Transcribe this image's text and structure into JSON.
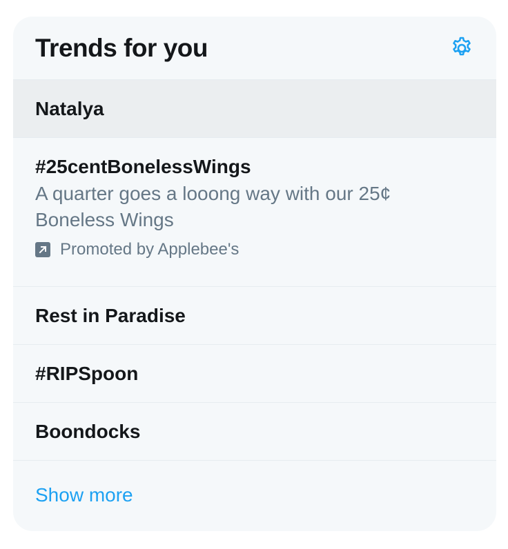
{
  "header": {
    "title": "Trends for you",
    "settings_icon": "gear-icon"
  },
  "trends": [
    {
      "name": "Natalya"
    },
    {
      "name": "#25centBonelessWings",
      "description": "A quarter goes a looong way with our 25¢ Boneless Wings",
      "promoted_label": "Promoted by Applebee's",
      "promoted_icon": "promoted-arrow-icon"
    },
    {
      "name": "Rest in Paradise"
    },
    {
      "name": "#RIPSpoon"
    },
    {
      "name": "Boondocks"
    }
  ],
  "footer": {
    "show_more": "Show more"
  },
  "colors": {
    "accent": "#1da1f2",
    "card_bg": "#f5f8fa",
    "hover_bg": "#ebeef0",
    "text_primary": "#14171a",
    "text_secondary": "#657786",
    "divider": "#e6ecf0"
  }
}
